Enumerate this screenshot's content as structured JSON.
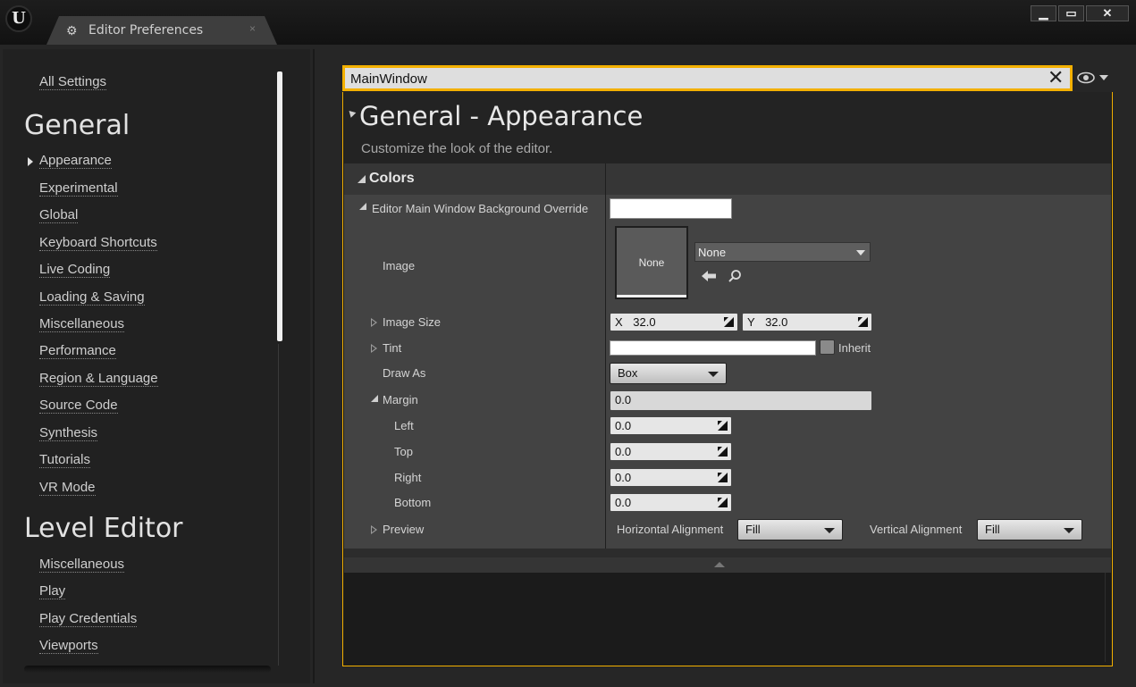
{
  "window": {
    "tab_title": "Editor Preferences",
    "tab_close": "×",
    "btn_min": "▁",
    "btn_max": "▭",
    "btn_close": "✕"
  },
  "sidebar": {
    "all_settings": "All Settings",
    "categories": [
      {
        "title": "General",
        "items": [
          "Appearance",
          "Experimental",
          "Global",
          "Keyboard Shortcuts",
          "Live Coding",
          "Loading & Saving",
          "Miscellaneous",
          "Performance",
          "Region & Language",
          "Source Code",
          "Synthesis",
          "Tutorials",
          "VR Mode"
        ]
      },
      {
        "title": "Level Editor",
        "items": [
          "Miscellaneous",
          "Play",
          "Play Credentials",
          "Viewports"
        ]
      }
    ],
    "selected": "Appearance"
  },
  "search": {
    "value": "MainWindow",
    "clear": "✕"
  },
  "details": {
    "title": "General - Appearance",
    "description": "Customize the look of the editor.",
    "category": "Colors",
    "props": {
      "bg_override": "Editor Main Window Background Override",
      "image": "Image",
      "thumb_text": "None",
      "asset_value": "None",
      "image_size": "Image Size",
      "x_label": "X",
      "x_value": "32.0",
      "y_label": "Y",
      "y_value": "32.0",
      "tint": "Tint",
      "inherit": "Inherit",
      "draw_as": "Draw As",
      "draw_as_value": "Box",
      "margin": "Margin",
      "margin_value": "0.0",
      "left": "Left",
      "left_value": "0.0",
      "top": "Top",
      "top_value": "0.0",
      "right": "Right",
      "right_value": "0.0",
      "bottom": "Bottom",
      "bottom_value": "0.0",
      "preview": "Preview",
      "h_align_label": "Horizontal Alignment",
      "h_align_value": "Fill",
      "v_align_label": "Vertical Alignment",
      "v_align_value": "Fill"
    }
  },
  "colors": {
    "accent": "#f3b000",
    "panel": "#434343",
    "sidebar": "#212121"
  }
}
